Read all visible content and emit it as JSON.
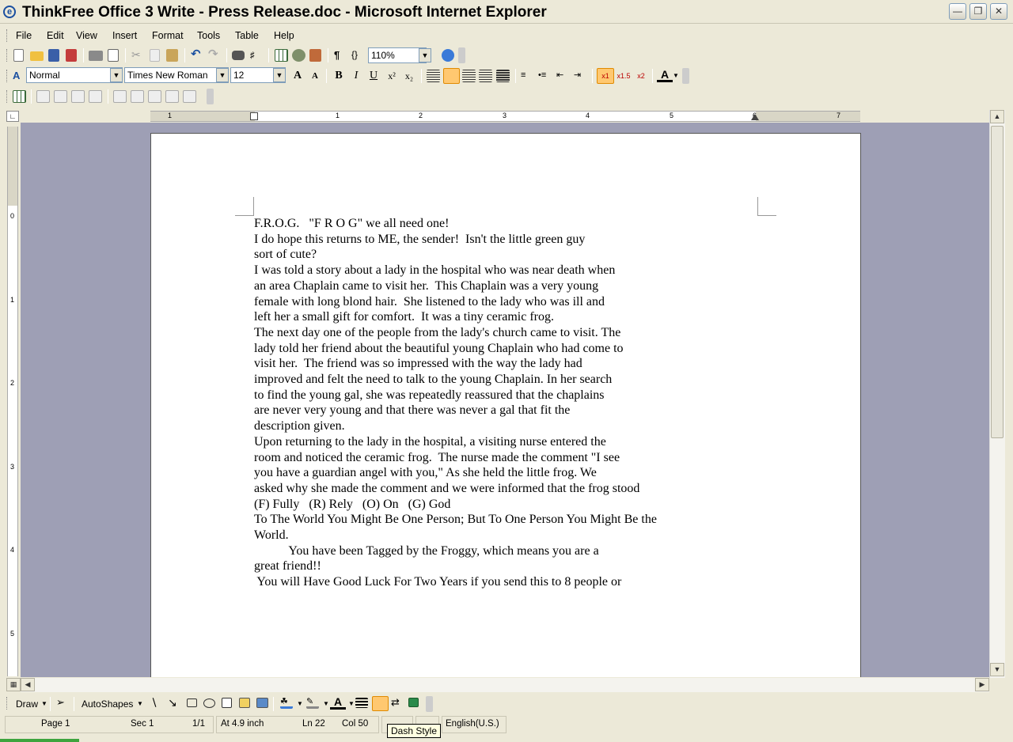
{
  "window": {
    "title": "ThinkFree Office 3 Write - Press Release.doc - Microsoft Internet Explorer"
  },
  "menu": [
    "File",
    "Edit",
    "View",
    "Insert",
    "Format",
    "Tools",
    "Table",
    "Help"
  ],
  "toolbar": {
    "zoom": "110%"
  },
  "format_bar": {
    "style": "Normal",
    "font": "Times New Roman",
    "size": "12",
    "bold": "B",
    "italic": "I",
    "underline": "U",
    "superscript": "x²",
    "subscript": "x₂",
    "font_color_glyph": "A",
    "grow_font_glyph": "A",
    "shrink_font_glyph": "A",
    "spacing_1": "x1",
    "spacing_15": "x1.5",
    "spacing_2": "x2"
  },
  "ruler": {
    "horizontal_numbers": [
      "1",
      "1",
      "2",
      "3",
      "4",
      "5",
      "6",
      "7"
    ],
    "vertical_numbers": [
      "0",
      "1",
      "2",
      "3",
      "4",
      "5"
    ]
  },
  "document": {
    "lines": [
      "F.R.O.G.   \"F R O G\" we all need one!",
      "I do hope this returns to ME, the sender!  Isn't the little green guy",
      "sort of cute?",
      "I was told a story about a lady in the hospital who was near death when",
      "an area Chaplain came to visit her.  This Chaplain was a very young",
      "female with long blond hair.  She listened to the lady who was ill and",
      "left her a small gift for comfort.  It was a tiny ceramic frog.",
      "The next day one of the people from the lady's church came to visit. The",
      "lady told her friend about the beautiful young Chaplain who had come to",
      "visit her.  The friend was so impressed with the way the lady had",
      "improved and felt the need to talk to the young Chaplain. In her search",
      "to find the young gal, she was repeatedly reassured that the chaplains",
      "are never very young and that there was never a gal that fit the",
      "description given.",
      "Upon returning to the lady in the hospital, a visiting nurse entered the",
      "room and noticed the ceramic frog.  The nurse made the comment \"I see",
      "you have a guardian angel with you,\" As she held the little frog. We",
      "asked why she made the comment and we were informed that the frog stood",
      "(F) Fully   (R) Rely   (O) On   (G) God",
      "To The World You Might Be One Person; But To One Person You Might Be the",
      "World.",
      "           You have been Tagged by the Froggy, which means you are a",
      "great friend!!",
      " You will Have Good Luck For Two Years if you send this to 8 people or"
    ]
  },
  "drawbar": {
    "draw": "Draw",
    "autoshapes": "AutoShapes"
  },
  "status": {
    "page": "Page 1",
    "sec": "Sec 1",
    "pages": "1/1",
    "at": "At 4.9 inch",
    "ln": "Ln 22",
    "col": "Col 50",
    "language": "English(U.S.)"
  },
  "tooltip": "Dash Style",
  "colors": {
    "chrome": "#ece9d8",
    "workspace": "#9e9fb5",
    "accent": "#1a4fa0"
  }
}
